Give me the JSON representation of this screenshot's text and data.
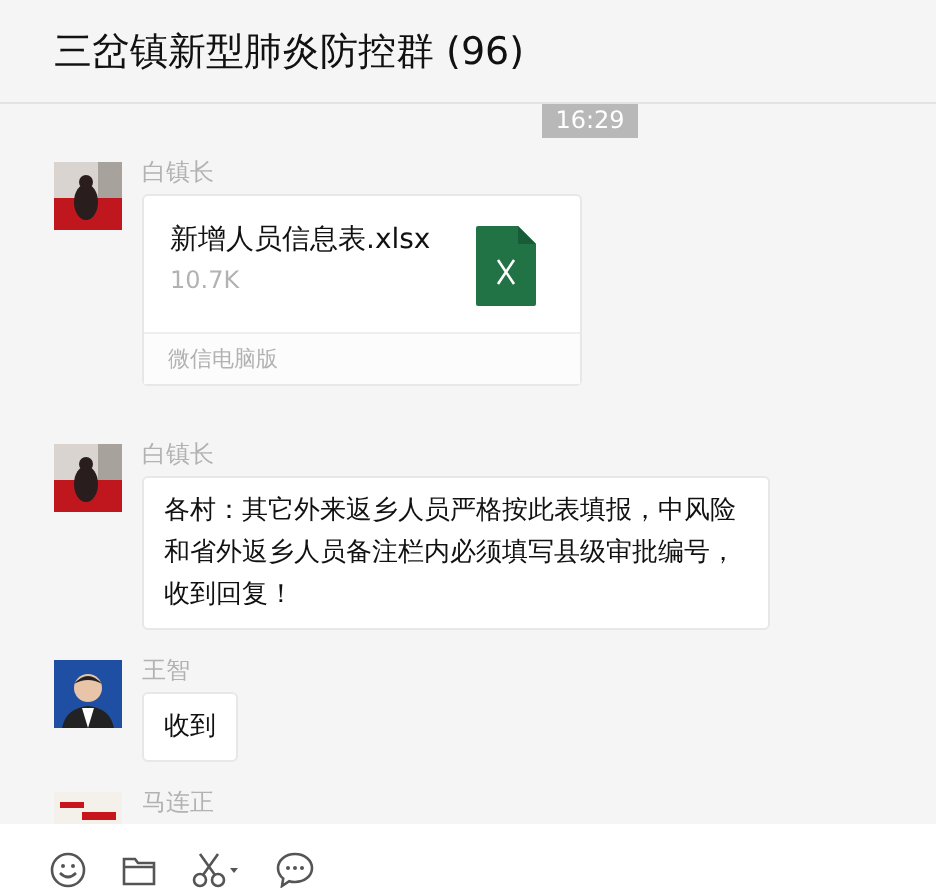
{
  "window": {
    "title": "三岔镇新型肺炎防控群 (96)"
  },
  "chat": {
    "time": "16:29",
    "messages": [
      {
        "sender": "白镇长",
        "kind": "file",
        "file_name": "新增人员信息表.xlsx",
        "file_size": "10.7K",
        "source": "微信电脑版"
      },
      {
        "sender": "白镇长",
        "kind": "text",
        "text": "各村：其它外来返乡人员严格按此表填报，中风险和省外返乡人员备注栏内必须填写县级审批编号，收到回复！"
      },
      {
        "sender": "王智",
        "kind": "text",
        "text": "收到"
      },
      {
        "sender": "马连正"
      }
    ]
  }
}
